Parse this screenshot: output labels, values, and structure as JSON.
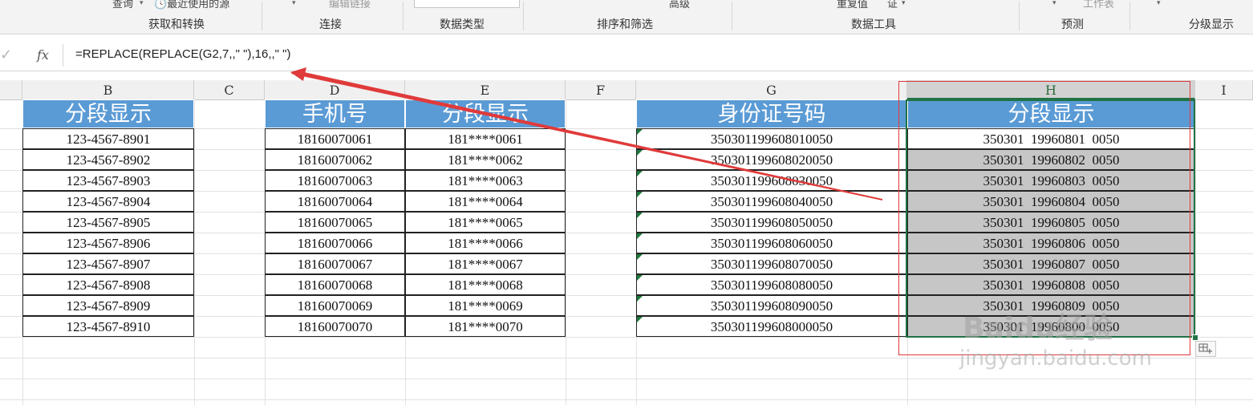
{
  "ribbon": {
    "top_items": [
      "查询",
      "最近使用的源",
      "编辑链接",
      "高级",
      "重复值",
      "证",
      "工作表"
    ],
    "groups": [
      "获取和转换",
      "连接",
      "数据类型",
      "排序和筛选",
      "数据工具",
      "预测",
      "分级显示"
    ]
  },
  "formula_bar": {
    "check_icon": "check-icon",
    "fx_label": "fx",
    "formula": "=REPLACE(REPLACE(G2,7,,\" \"),16,,\" \")"
  },
  "columns": [
    "B",
    "C",
    "D",
    "E",
    "F",
    "G",
    "H",
    "I"
  ],
  "table_b": {
    "header": "分段显示",
    "rows": [
      "123-4567-8901",
      "123-4567-8902",
      "123-4567-8903",
      "123-4567-8904",
      "123-4567-8905",
      "123-4567-8906",
      "123-4567-8907",
      "123-4567-8908",
      "123-4567-8909",
      "123-4567-8910"
    ]
  },
  "table_de": {
    "headers": [
      "手机号",
      "分段显示"
    ],
    "phones": [
      "18160070061",
      "18160070062",
      "18160070063",
      "18160070064",
      "18160070065",
      "18160070066",
      "18160070067",
      "18160070068",
      "18160070069",
      "18160070070"
    ],
    "masked": [
      "181****0061",
      "181****0062",
      "181****0063",
      "181****0064",
      "181****0065",
      "181****0066",
      "181****0067",
      "181****0068",
      "181****0069",
      "181****0070"
    ]
  },
  "table_gh": {
    "headers": [
      "身份证号码",
      "分段显示"
    ],
    "ids": [
      "350301199608010050",
      "350301199608020050",
      "350301199608030050",
      "350301199608040050",
      "350301199608050050",
      "350301199608060050",
      "350301199608070050",
      "350301199608080050",
      "350301199608090050",
      "350301199608000050"
    ],
    "segmented": [
      "350301  19960801  0050",
      "350301  19960802  0050",
      "350301  19960803  0050",
      "350301  19960804  0050",
      "350301  19960805  0050",
      "350301  19960806  0050",
      "350301  19960807  0050",
      "350301  19960808  0050",
      "350301  19960809  0050",
      "350301  19960800  0050"
    ]
  },
  "watermark": {
    "brand": "Baidu经验",
    "url": "jingyan.baidu.com"
  },
  "colors": {
    "header_fill": "#5b9bd5",
    "selection": "#217346",
    "annotation": "#e03a3a",
    "shade": "#c6c6c6"
  }
}
